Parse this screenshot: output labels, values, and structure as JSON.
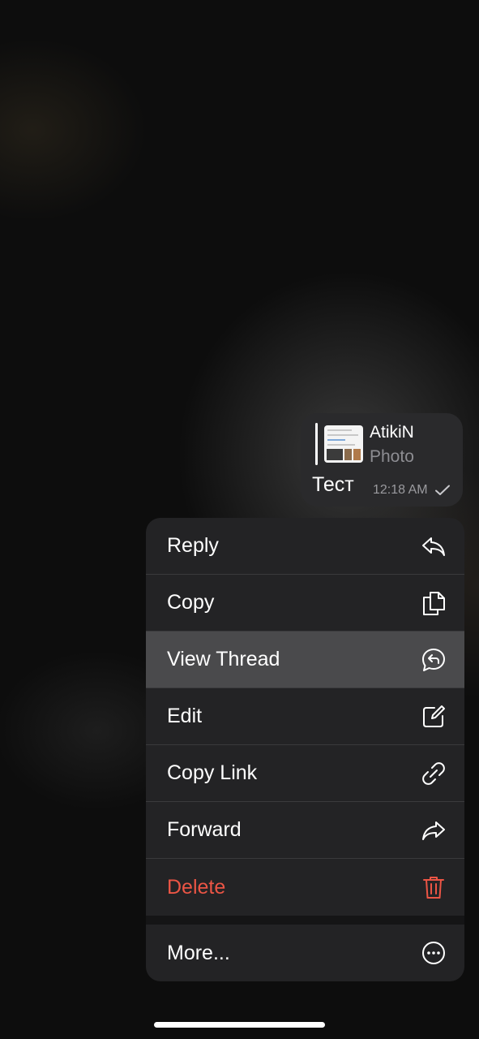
{
  "message": {
    "reply_author": "AtikiN",
    "reply_preview": "Photo",
    "text": "Тест",
    "time": "12:18 AM",
    "status_icon": "checkmark-icon"
  },
  "menu": {
    "items": [
      {
        "label": "Reply",
        "icon": "reply-icon"
      },
      {
        "label": "Copy",
        "icon": "copy-icon"
      },
      {
        "label": "View Thread",
        "icon": "thread-icon"
      },
      {
        "label": "Edit",
        "icon": "edit-icon"
      },
      {
        "label": "Copy Link",
        "icon": "link-icon"
      },
      {
        "label": "Forward",
        "icon": "forward-icon"
      },
      {
        "label": "Delete",
        "icon": "trash-icon"
      },
      {
        "label": "More...",
        "icon": "more-icon"
      }
    ],
    "highlighted": "View Thread"
  },
  "colors": {
    "danger": "#eb5545",
    "menu_background": "#232325",
    "highlight": "#4a4a4c",
    "bubble": "#2a2a2c"
  }
}
